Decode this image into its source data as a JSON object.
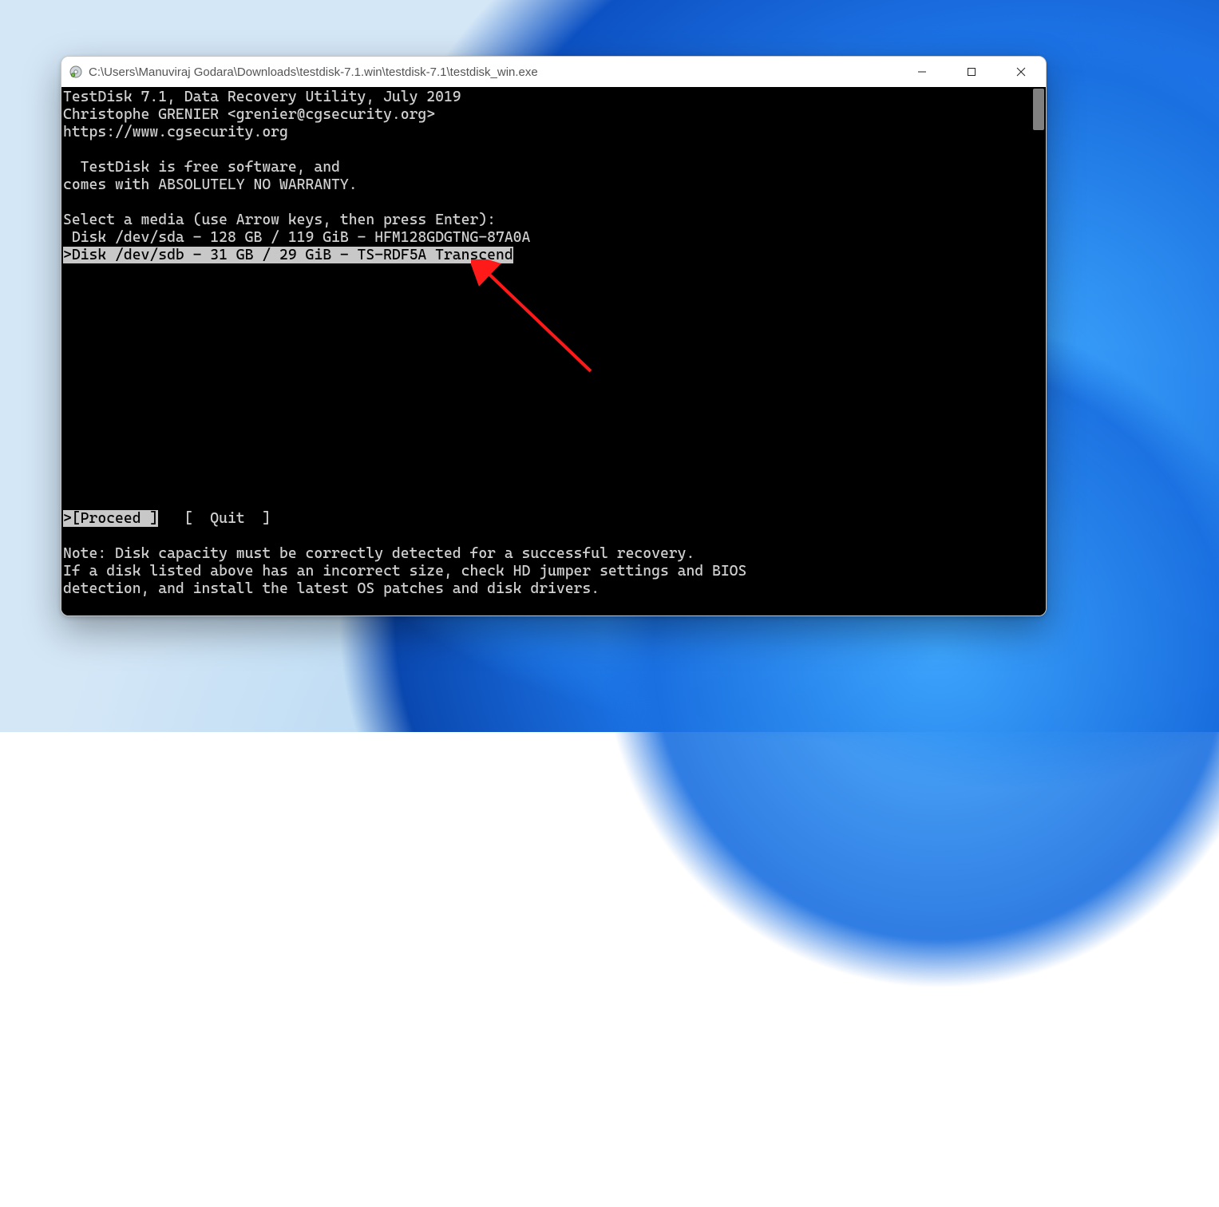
{
  "window": {
    "title": "C:\\Users\\Manuviraj Godara\\Downloads\\testdisk-7.1.win\\testdisk-7.1\\testdisk_win.exe"
  },
  "terminal": {
    "header": [
      "TestDisk 7.1, Data Recovery Utility, July 2019",
      "Christophe GRENIER <grenier@cgsecurity.org>",
      "https://www.cgsecurity.org"
    ],
    "intro": [
      "  TestDisk is free software, and",
      "comes with ABSOLUTELY NO WARRANTY."
    ],
    "select_prompt": "Select a media (use Arrow keys, then press Enter):",
    "disks": [
      {
        "text": " Disk /dev/sda - 128 GB / 119 GiB - HFM128GDGTNG-87A0A",
        "selected": false
      },
      {
        "text": ">Disk /dev/sdb - 31 GB / 29 GiB - TS-RDF5A Transcend",
        "selected": true
      }
    ],
    "menu": {
      "proceed": ">[Proceed ]",
      "gap": "   ",
      "quit": "[  Quit  ]"
    },
    "note": [
      "Note: Disk capacity must be correctly detected for a successful recovery.",
      "If a disk listed above has an incorrect size, check HD jumper settings and BIOS",
      "detection, and install the latest OS patches and disk drivers."
    ]
  }
}
